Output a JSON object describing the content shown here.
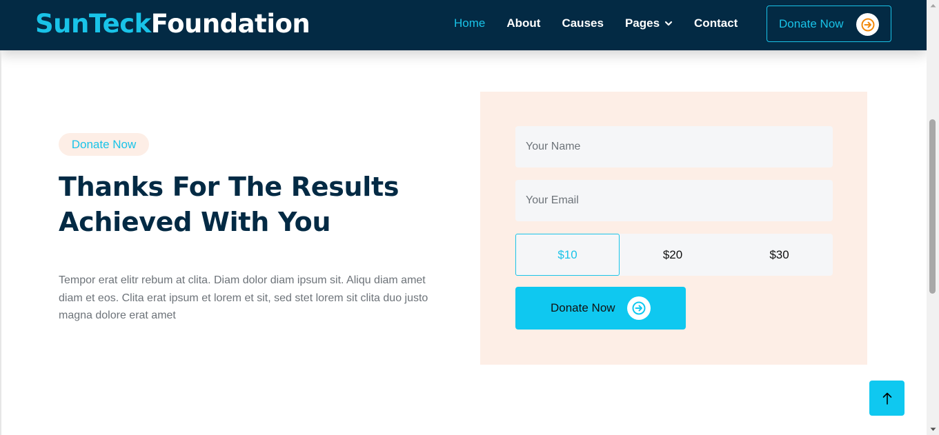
{
  "brand": {
    "part1": "SunTeck",
    "part2": "Foundation"
  },
  "nav": {
    "items": [
      {
        "label": "Home"
      },
      {
        "label": "About"
      },
      {
        "label": "Causes"
      },
      {
        "label": "Pages"
      },
      {
        "label": "Contact"
      }
    ],
    "active": "Home",
    "donate_label": "Donate Now"
  },
  "hero": {
    "badge": "Donate Now",
    "heading_line1": "Thanks For The Results",
    "heading_line2": "Achieved With You",
    "paragraph": "Tempor erat elitr rebum at clita. Diam dolor diam ipsum sit. Aliqu diam amet diam et eos. Clita erat ipsum et lorem et sit, sed stet lorem sit clita duo justo magna dolore erat amet"
  },
  "form": {
    "name_placeholder": "Your Name",
    "email_placeholder": "Your Email",
    "amounts": [
      "$10",
      "$20",
      "$30"
    ],
    "selected_amount": "$10",
    "submit_label": "Donate Now"
  },
  "colors": {
    "navy": "#032a44",
    "accent": "#19c3e8",
    "button": "#0fc8f0",
    "panel": "#fdeee6",
    "orange": "#f2890b"
  },
  "icons": {
    "nav_donate": "arrow-right-icon",
    "form_submit": "arrow-right-icon",
    "pages_dropdown": "chevron-down-icon",
    "back_to_top": "arrow-up-icon"
  }
}
